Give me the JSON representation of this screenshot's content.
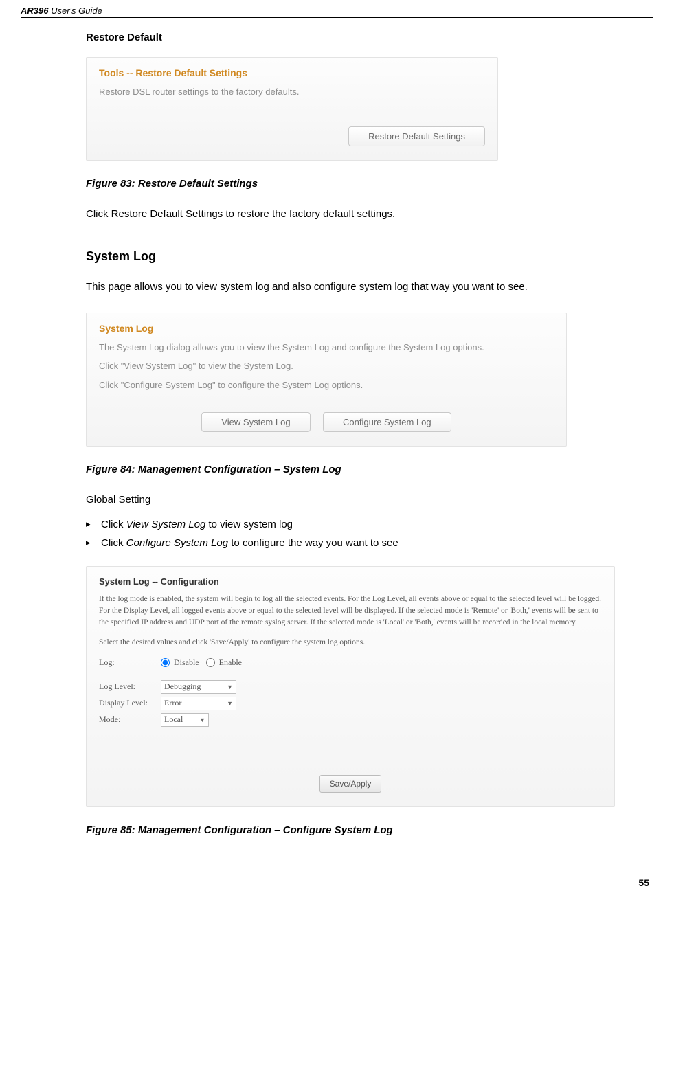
{
  "header": {
    "product": "AR396",
    "guide": "User's Guide"
  },
  "restore": {
    "heading": "Restore Default",
    "panel_title": "Tools -- Restore Default Settings",
    "panel_desc": "Restore DSL router settings to the factory defaults.",
    "button": "Restore Default Settings",
    "fig_caption": "Figure 83: Restore Default Settings",
    "body": "Click Restore Default Settings to restore the factory default settings."
  },
  "syslog": {
    "title": "System Log",
    "intro": "This page allows you to view system log and also configure system log that way you want to see.",
    "panel_title": "System Log",
    "desc1": "The System Log dialog allows you to view the System Log and configure the System Log options.",
    "desc2": "Click \"View System Log\" to view the System Log.",
    "desc3": "Click \"Configure System Log\" to configure the System Log options.",
    "btn_view": "View System Log",
    "btn_conf": "Configure System Log",
    "fig_caption": "Figure 84: Management Configuration – System Log",
    "global_heading": "Global Setting",
    "bullet1_pre": "Click ",
    "bullet1_em": "View System Log",
    "bullet1_post": " to view system log",
    "bullet2_pre": "Click ",
    "bullet2_em": "Configure System Log",
    "bullet2_post": " to configure the way you want to see"
  },
  "conf": {
    "panel_title": "System Log -- Configuration",
    "para1": "If the log mode is enabled, the system will begin to log all the selected events. For the Log Level, all events above or equal to the selected level will be logged. For the Display Level, all logged events above or equal to the selected level will be displayed. If the selected mode is 'Remote' or 'Both,' events will be sent to the specified IP address and UDP port of the remote syslog server. If the selected mode is 'Local' or 'Both,' events will be recorded in the local memory.",
    "para2": "Select the desired values and click 'Save/Apply' to configure the system log options.",
    "log_label": "Log:",
    "disable": "Disable",
    "enable": "Enable",
    "loglevel_label": "Log Level:",
    "loglevel_value": "Debugging",
    "displevel_label": "Display Level:",
    "displevel_value": "Error",
    "mode_label": "Mode:",
    "mode_value": "Local",
    "save_btn": "Save/Apply",
    "fig_caption": "Figure 85: Management Configuration – Configure System Log"
  },
  "footer": {
    "page": "55"
  }
}
